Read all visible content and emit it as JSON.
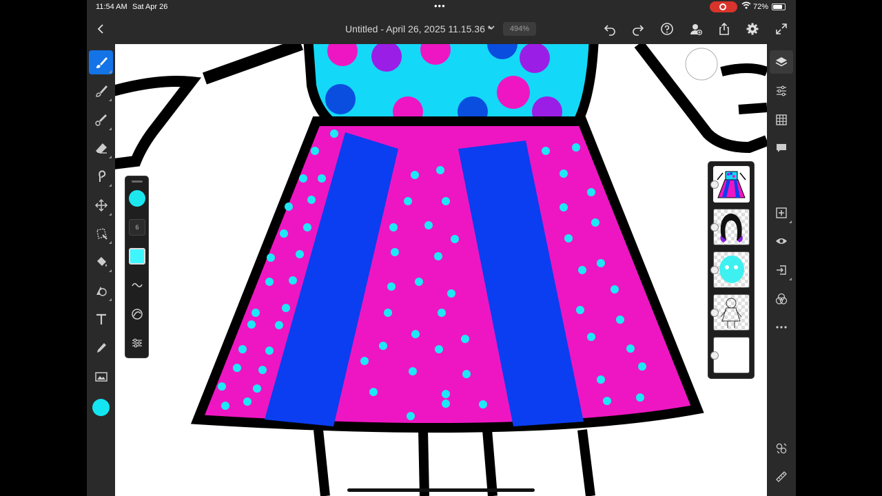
{
  "status_bar": {
    "time": "11:54 AM",
    "date": "Sat Apr 26",
    "battery": "72%"
  },
  "top_bar": {
    "title": "Untitled - April 26, 2025 11.15.36 *",
    "zoom": "494%",
    "icons": [
      "back-icon",
      "chevron-down-icon",
      "undo-icon",
      "redo-icon",
      "help-icon",
      "user-add-icon",
      "share-icon",
      "settings-icon",
      "fullscreen-icon"
    ]
  },
  "left_toolbar": {
    "tools": [
      "paint-brush-icon",
      "pixel-brush-icon",
      "vector-brush-icon",
      "eraser-icon",
      "smudge-icon",
      "move-icon",
      "transform-icon",
      "fill-icon",
      "shape-icon",
      "text-icon",
      "eyedropper-icon",
      "image-icon"
    ],
    "active_tool": "paint-brush-icon",
    "current_color": "#14e6f1"
  },
  "brush_panel": {
    "color": "#1ce7ef",
    "size": "6",
    "opacity_color": "#3ff6ff",
    "icons": [
      "stroke-smoothing-icon",
      "brush-blend-icon",
      "brush-settings-icon"
    ]
  },
  "layers_panel": {
    "layer_count": 5,
    "selected_index": 0,
    "layers": [
      "dress",
      "hair",
      "face",
      "sketch",
      "blank"
    ]
  },
  "right_toolbar": {
    "tools": [
      "layers-icon",
      "layer-properties-icon",
      "grid-icon",
      "comment-icon",
      "add-layer-icon",
      "visibility-icon",
      "import-icon",
      "blend-mode-icon",
      "more-icon",
      "adjust-icon",
      "ruler-icon"
    ]
  },
  "colors": {
    "accent": "#1473e6",
    "dress_pink": "#ee16c2",
    "dress_blue": "#0a3ef0",
    "dots_cyan": "#1ee8f5",
    "top_cyan": "#14d8f7",
    "top_dot_purple": "#9b1ee6",
    "top_dot_blue": "#0a4ee0",
    "outline": "#000000"
  }
}
